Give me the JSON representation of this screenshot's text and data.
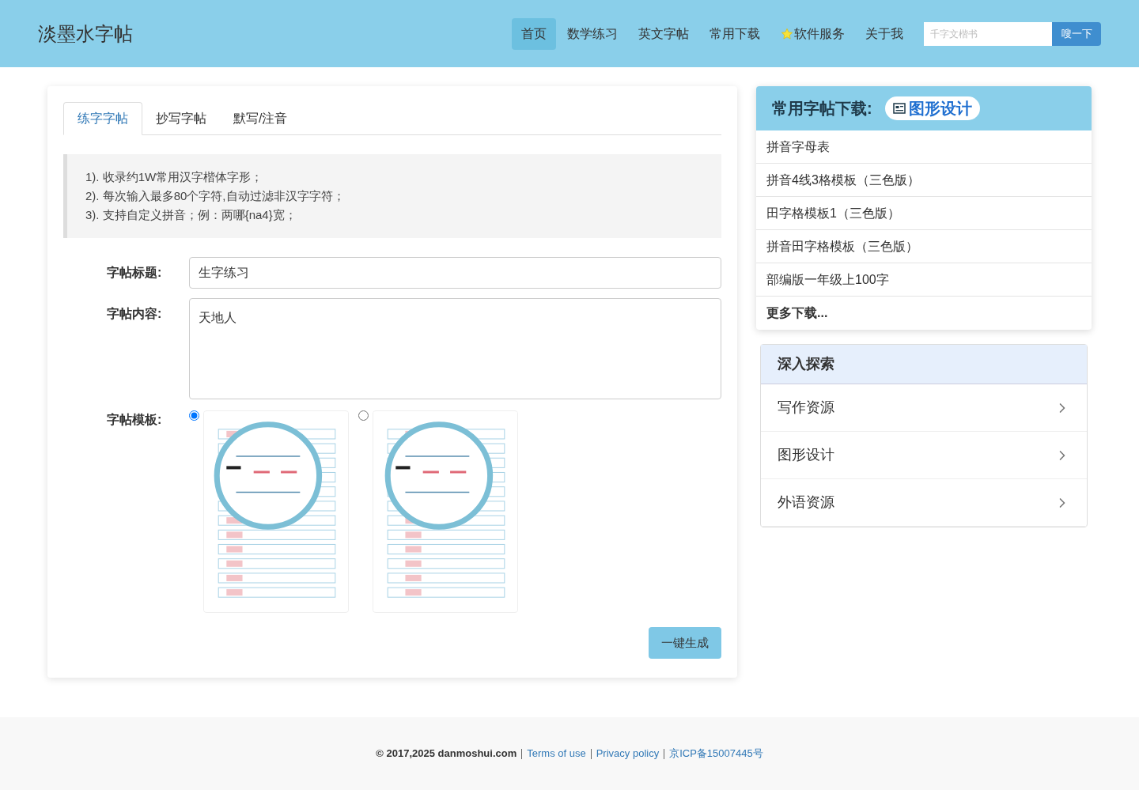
{
  "header": {
    "logo": "淡墨水字帖",
    "nav": [
      {
        "label": "首页",
        "selected": true,
        "star": false
      },
      {
        "label": "数学练习",
        "selected": false,
        "star": false
      },
      {
        "label": "英文字帖",
        "selected": false,
        "star": false
      },
      {
        "label": "常用下载",
        "selected": false,
        "star": false
      },
      {
        "label": "软件服务",
        "selected": false,
        "star": true
      },
      {
        "label": "关于我",
        "selected": false,
        "star": false
      }
    ],
    "search": {
      "placeholder": "千字文楷书",
      "button": "嗖一下"
    }
  },
  "tabs": [
    {
      "label": "练字字帖",
      "selected": true
    },
    {
      "label": "抄写字帖",
      "selected": false
    },
    {
      "label": "默写/注音",
      "selected": false
    }
  ],
  "notes": [
    "1). 收录约1W常用汉字楷体字形；",
    "2). 每次输入最多80个字符,自动过滤非汉字字符；",
    "3). 支持自定义拼音；例：两哪{na4}宽；"
  ],
  "form": {
    "title_label": "字帖标题:",
    "title_value": "生字练习",
    "content_label": "字帖内容:",
    "content_value": "天地人",
    "template_label": "字帖模板:",
    "templates": [
      {
        "selected": true,
        "kind": "picture"
      },
      {
        "selected": false,
        "kind": "picture"
      }
    ],
    "submit": "一键生成"
  },
  "downloads": {
    "title": "常用字帖下载:",
    "badge": "图形设计",
    "items": [
      "拼音字母表",
      "拼音4线3格模板（三色版）",
      "田字格模板1（三色版）",
      "拼音田字格模板（三色版）",
      "部编版一年级上100字"
    ],
    "more": "更多下载..."
  },
  "explore": {
    "title": "深入探索",
    "items": [
      "写作资源",
      "图形设计",
      "外语资源"
    ]
  },
  "footer": {
    "copyright": "© 2017,2025 danmoshui.com",
    "links": [
      "Terms of use",
      "Privacy policy",
      "京ICP备15007445号"
    ]
  }
}
